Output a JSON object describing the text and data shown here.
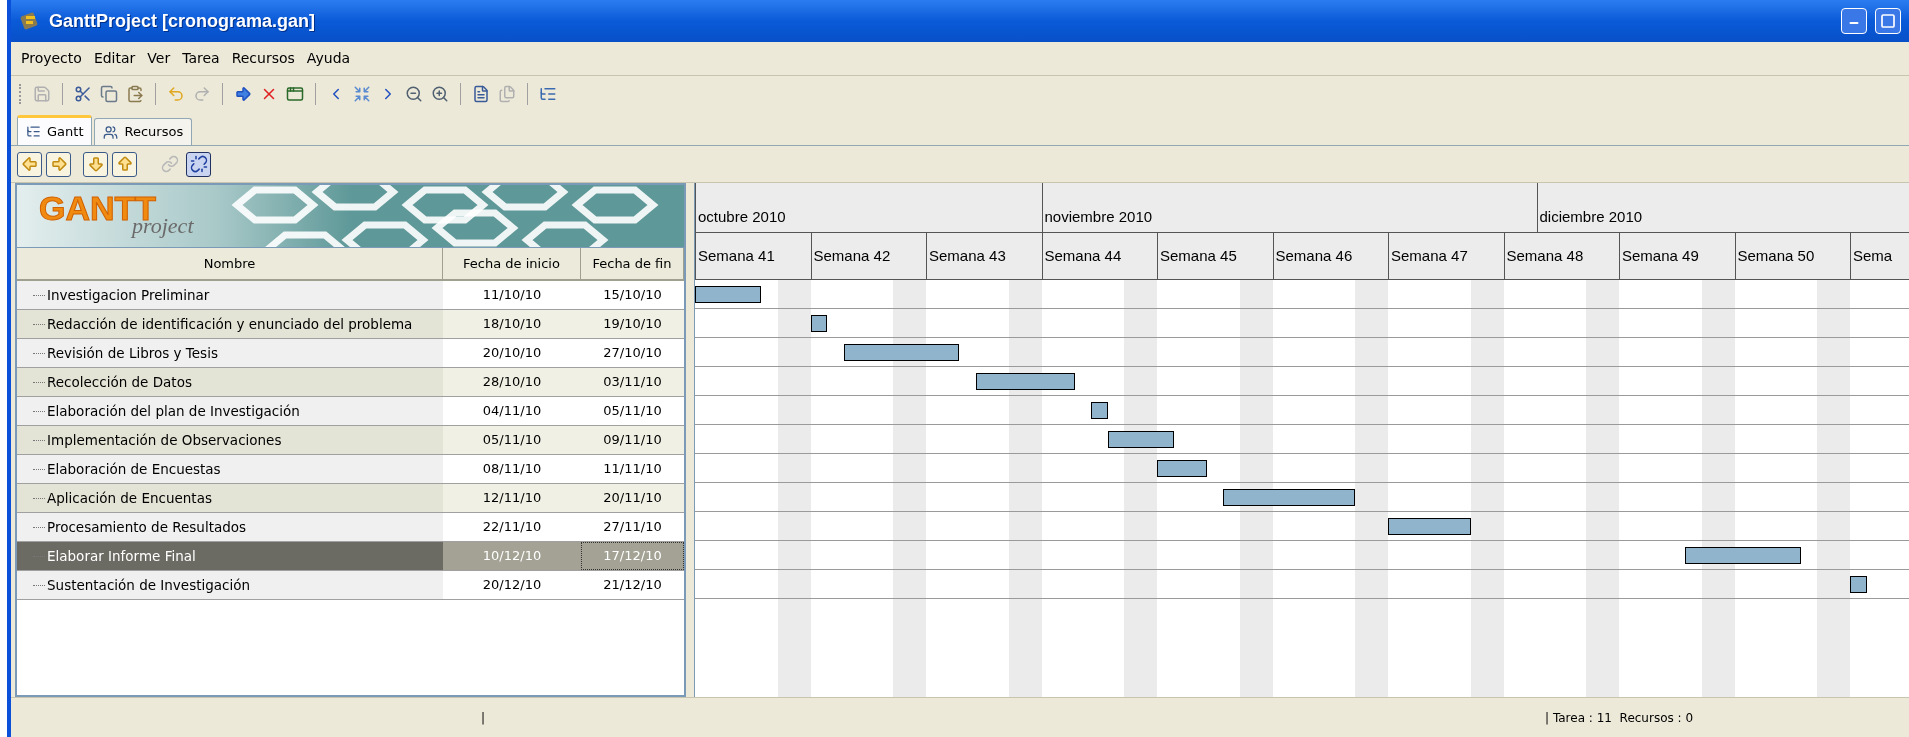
{
  "window": {
    "title": "GanttProject [cronograma.gan]"
  },
  "menu": [
    "Proyecto",
    "Editar",
    "Ver",
    "Tarea",
    "Recursos",
    "Ayuda"
  ],
  "tabs": [
    {
      "label": "Gantt",
      "selected": true
    },
    {
      "label": "Recursos",
      "selected": false
    }
  ],
  "logo": {
    "title": "GANTT",
    "subtitle": "project"
  },
  "table": {
    "columns": [
      "Nombre",
      "Fecha de inicio",
      "Fecha de fin"
    ],
    "rows": [
      {
        "name": "Investigacion Preliminar",
        "start": "11/10/10",
        "end": "15/10/10",
        "selected": false
      },
      {
        "name": "Redacción de identificación y enunciado del problema",
        "start": "18/10/10",
        "end": "19/10/10",
        "selected": false
      },
      {
        "name": "Revisión de Libros y Tesis",
        "start": "20/10/10",
        "end": "27/10/10",
        "selected": false
      },
      {
        "name": "Recolección de Datos",
        "start": "28/10/10",
        "end": "03/11/10",
        "selected": false
      },
      {
        "name": "Elaboración del plan de Investigación",
        "start": "04/11/10",
        "end": "05/11/10",
        "selected": false
      },
      {
        "name": "Implementación de Observaciones",
        "start": "05/11/10",
        "end": "09/11/10",
        "selected": false
      },
      {
        "name": "Elaboración de Encuestas",
        "start": "08/11/10",
        "end": "11/11/10",
        "selected": false
      },
      {
        "name": "Aplicación de Encuentas",
        "start": "12/11/10",
        "end": "20/11/10",
        "selected": false
      },
      {
        "name": "Procesamiento de Resultados",
        "start": "22/11/10",
        "end": "27/11/10",
        "selected": false
      },
      {
        "name": "Elaborar Informe Final",
        "start": "10/12/10",
        "end": "17/12/10",
        "selected": true
      },
      {
        "name": "Sustentación de Investigación",
        "start": "20/12/10",
        "end": "21/12/10",
        "selected": false
      }
    ]
  },
  "timeline": {
    "months": [
      "octubre 2010",
      "noviembre 2010",
      "diciembre 2010"
    ],
    "weeks": [
      "Semana 41",
      "Semana 42",
      "Semana 43",
      "Semana 44",
      "Semana 45",
      "Semana 46",
      "Semana 47",
      "Semana 48",
      "Semana 49",
      "Semana 50",
      "Sema"
    ]
  },
  "status_bar": [
    "|",
    "| Tarea : 11  Recursos : 0"
  ]
}
